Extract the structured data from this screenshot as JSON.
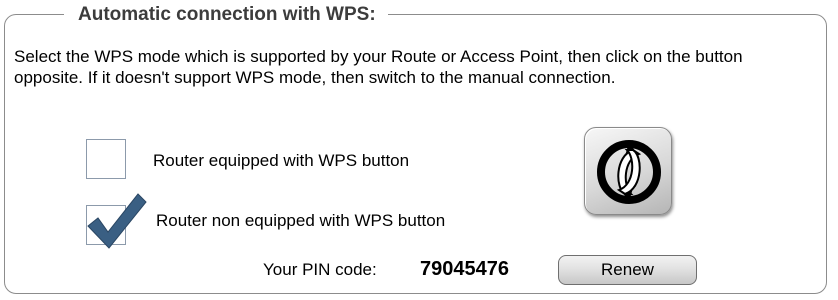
{
  "section": {
    "title": "Automatic connection with WPS:",
    "description": "Select the WPS mode which is supported by your Route or Access Point, then click on the button opposite. If it doesn't support WPS mode, then switch to the manual connection."
  },
  "options": [
    {
      "label": "Router equipped with WPS button",
      "checked": false
    },
    {
      "label": "Router non equipped with WPS button",
      "checked": true
    }
  ],
  "wps_button": {
    "icon": "wps-icon"
  },
  "pin": {
    "label": "Your PIN code:",
    "value": "79045476"
  },
  "renew_button": {
    "label": "Renew"
  },
  "colors": {
    "checkmark": "#3a5f83",
    "checkbox_border": "#8c9aab",
    "group_border": "#8c8c8c"
  }
}
